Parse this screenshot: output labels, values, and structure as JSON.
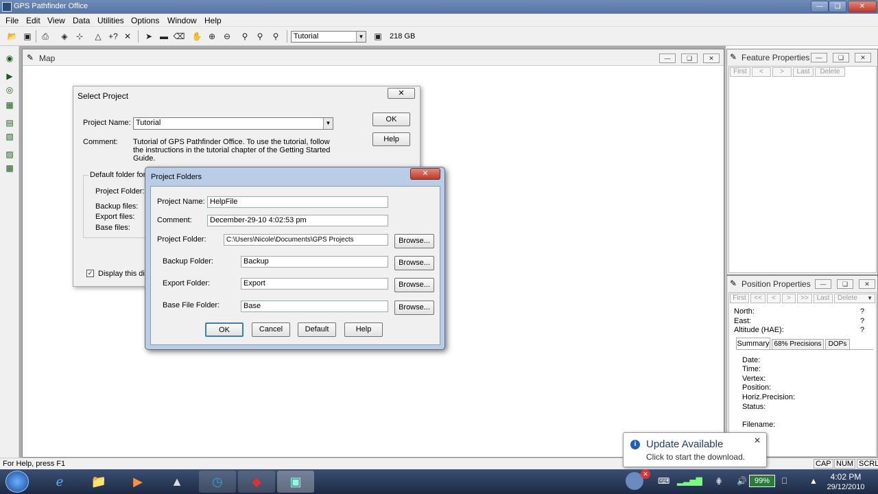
{
  "app": {
    "title": "GPS Pathfinder Office"
  },
  "menu": [
    "File",
    "Edit",
    "View",
    "Data",
    "Utilities",
    "Options",
    "Window",
    "Help"
  ],
  "toolbar": {
    "project_combo": "Tutorial",
    "disk_space": "218 GB"
  },
  "map_window": {
    "title": "Map"
  },
  "select_project": {
    "title": "Select Project",
    "project_name_label": "Project Name:",
    "project_name_value": "Tutorial",
    "comment_label": "Comment:",
    "comment_value": "Tutorial of GPS Pathfinder Office.  To use the tutorial, follow the instructions in the tutorial chapter of the Getting Started Guide.",
    "ok": "OK",
    "help": "Help",
    "group_label": "Default folder for",
    "project_folder_label": "Project Folder:",
    "backup_label": "Backup files:",
    "export_label": "Export files:",
    "base_label": "Base files:",
    "display_checkbox": "Display this dial"
  },
  "project_folders": {
    "title": "Project Folders",
    "project_name_label": "Project Name:",
    "project_name_value": "HelpFile",
    "comment_label": "Comment:",
    "comment_value": "December-29-10 4:02:53 pm",
    "project_folder_label": "Project Folder:",
    "project_folder_value": "C:\\Users\\Nicole\\Documents\\GPS Projects",
    "backup_label": "Backup Folder:",
    "backup_value": "Backup",
    "export_label": "Export Folder:",
    "export_value": "Export",
    "base_label": "Base File Folder:",
    "base_value": "Base",
    "browse": "Browse...",
    "ok": "OK",
    "cancel": "Cancel",
    "default": "Default",
    "help": "Help"
  },
  "feature_properties": {
    "title": "Feature Properties",
    "nav": [
      "First",
      "<",
      ">",
      "Last",
      "Delete"
    ]
  },
  "position_properties": {
    "title": "Position Properties",
    "nav": [
      "First",
      "<<",
      "<",
      ">",
      ">>",
      "Last",
      "Delete"
    ],
    "north_label": "North:",
    "east_label": "East:",
    "altitude_label": "Altitude (HAE):",
    "unknown": "?",
    "tabs": [
      "Summary",
      "68% Precisions",
      "DOPs"
    ],
    "fields": [
      "Date:",
      "Time:",
      "Vertex:",
      "Position:",
      "Horiz.Precision:",
      "Status:"
    ],
    "filename_label": "Filename:"
  },
  "statusbar": {
    "help": "For Help, press F1",
    "cap": "CAP",
    "num": "NUM",
    "scrl": "SCRL"
  },
  "notification": {
    "title": "Update Available",
    "body": "Click to start the download."
  },
  "taskbar": {
    "battery": "99%",
    "time": "4:02 PM",
    "date": "29/12/2010"
  }
}
